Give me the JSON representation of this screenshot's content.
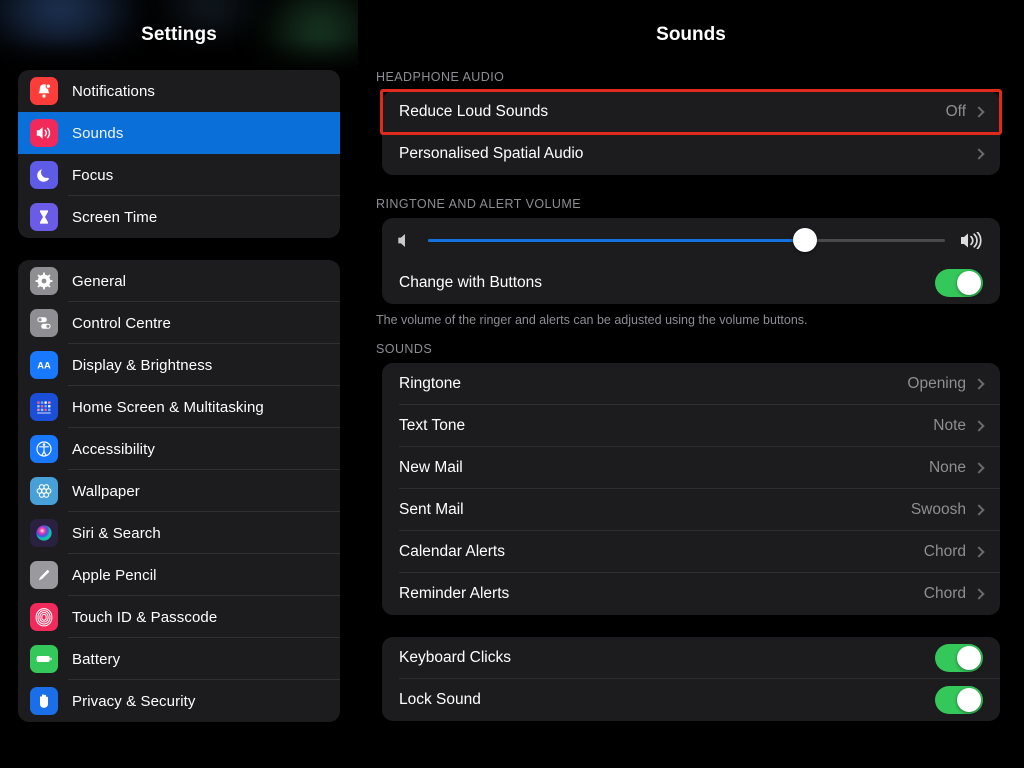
{
  "sidebar": {
    "title": "Settings",
    "groups": [
      {
        "items": [
          {
            "label": "Notifications",
            "icon": "bell-icon",
            "color": "#fc3d39",
            "selected": false
          },
          {
            "label": "Sounds",
            "icon": "speaker-waves-icon",
            "color": "#f2295b",
            "selected": true
          },
          {
            "label": "Focus",
            "icon": "moon-icon",
            "color": "#5e5ce6",
            "selected": false
          },
          {
            "label": "Screen Time",
            "icon": "hourglass-icon",
            "color": "#6b5ce7",
            "selected": false
          }
        ]
      },
      {
        "items": [
          {
            "label": "General",
            "icon": "gear-icon",
            "color": "#8e8e93",
            "selected": false
          },
          {
            "label": "Control Centre",
            "icon": "switches-icon",
            "color": "#8e8e93",
            "selected": false
          },
          {
            "label": "Display & Brightness",
            "icon": "aa-icon",
            "color": "#1878ff",
            "selected": false
          },
          {
            "label": "Home Screen & Multitasking",
            "icon": "app-grid-icon",
            "color": "#1c4fd8",
            "selected": false
          },
          {
            "label": "Accessibility",
            "icon": "accessibility-icon",
            "color": "#1878ff",
            "selected": false
          },
          {
            "label": "Wallpaper",
            "icon": "flower-icon",
            "color": "#47a0d8",
            "selected": false
          },
          {
            "label": "Siri & Search",
            "icon": "siri-orb-icon",
            "color": "#2a2140",
            "selected": false
          },
          {
            "label": "Apple Pencil",
            "icon": "pencil-icon",
            "color": "#9a9a9e",
            "selected": false
          },
          {
            "label": "Touch ID & Passcode",
            "icon": "fingerprint-icon",
            "color": "#f2295b",
            "selected": false
          },
          {
            "label": "Battery",
            "icon": "battery-icon",
            "color": "#34c759",
            "selected": false
          },
          {
            "label": "Privacy & Security",
            "icon": "hand-icon",
            "color": "#1a6ee8",
            "selected": false
          }
        ]
      }
    ]
  },
  "content": {
    "title": "Sounds",
    "sections": [
      {
        "header": "HEADPHONE AUDIO",
        "rows": [
          {
            "label": "Reduce Loud Sounds",
            "value": "Off",
            "chevron": true,
            "highlighted": true
          },
          {
            "label": "Personalised Spatial Audio",
            "value": "",
            "chevron": true,
            "highlighted": false
          }
        ]
      },
      {
        "header": "RINGTONE AND ALERT VOLUME",
        "slider": {
          "value_percent": 73,
          "left_icon": "speaker-low-icon",
          "right_icon": "speaker-high-icon",
          "fill_color": "#1273e0"
        },
        "toggle_row": {
          "label": "Change with Buttons",
          "on": true
        },
        "footnote": "The volume of the ringer and alerts can be adjusted using the volume buttons."
      },
      {
        "header": "SOUNDS",
        "rows": [
          {
            "label": "Ringtone",
            "value": "Opening",
            "chevron": true
          },
          {
            "label": "Text Tone",
            "value": "Note",
            "chevron": true
          },
          {
            "label": "New Mail",
            "value": "None",
            "chevron": true
          },
          {
            "label": "Sent Mail",
            "value": "Swoosh",
            "chevron": true
          },
          {
            "label": "Calendar Alerts",
            "value": "Chord",
            "chevron": true
          },
          {
            "label": "Reminder Alerts",
            "value": "Chord",
            "chevron": true
          }
        ]
      },
      {
        "header": "",
        "toggles": [
          {
            "label": "Keyboard Clicks",
            "on": true
          },
          {
            "label": "Lock Sound",
            "on": true
          }
        ]
      }
    ]
  },
  "highlight": {
    "color": "#e02a1c",
    "target": "Reduce Loud Sounds"
  }
}
